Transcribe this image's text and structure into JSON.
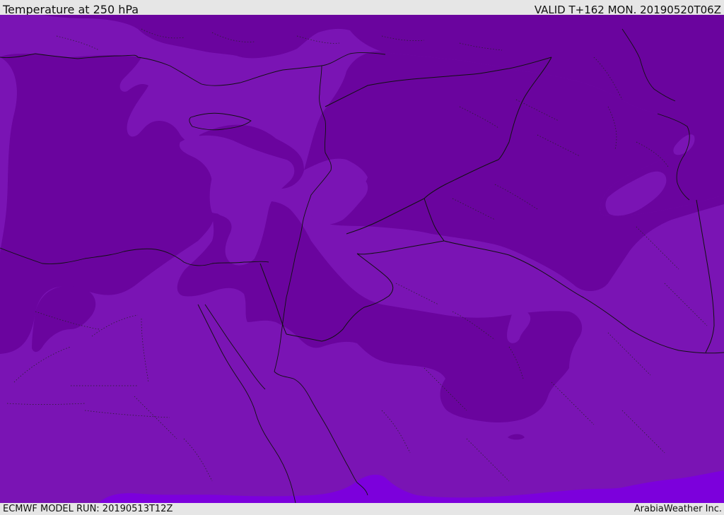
{
  "header": {
    "title": "Temperature at 250 hPa",
    "valid_label": "VALID T+162 MON. 20190520T06Z"
  },
  "footer": {
    "model_run": "ECMWF MODEL RUN: 20190513T12Z",
    "credit": "ArabiaWeather Inc."
  },
  "map": {
    "colors": {
      "frame": "#e6e6e6",
      "temp_mid": "#7a14b4",
      "temp_cold": "#6a049e",
      "temp_warm": "#7c00dc",
      "lines": "#111111"
    }
  }
}
